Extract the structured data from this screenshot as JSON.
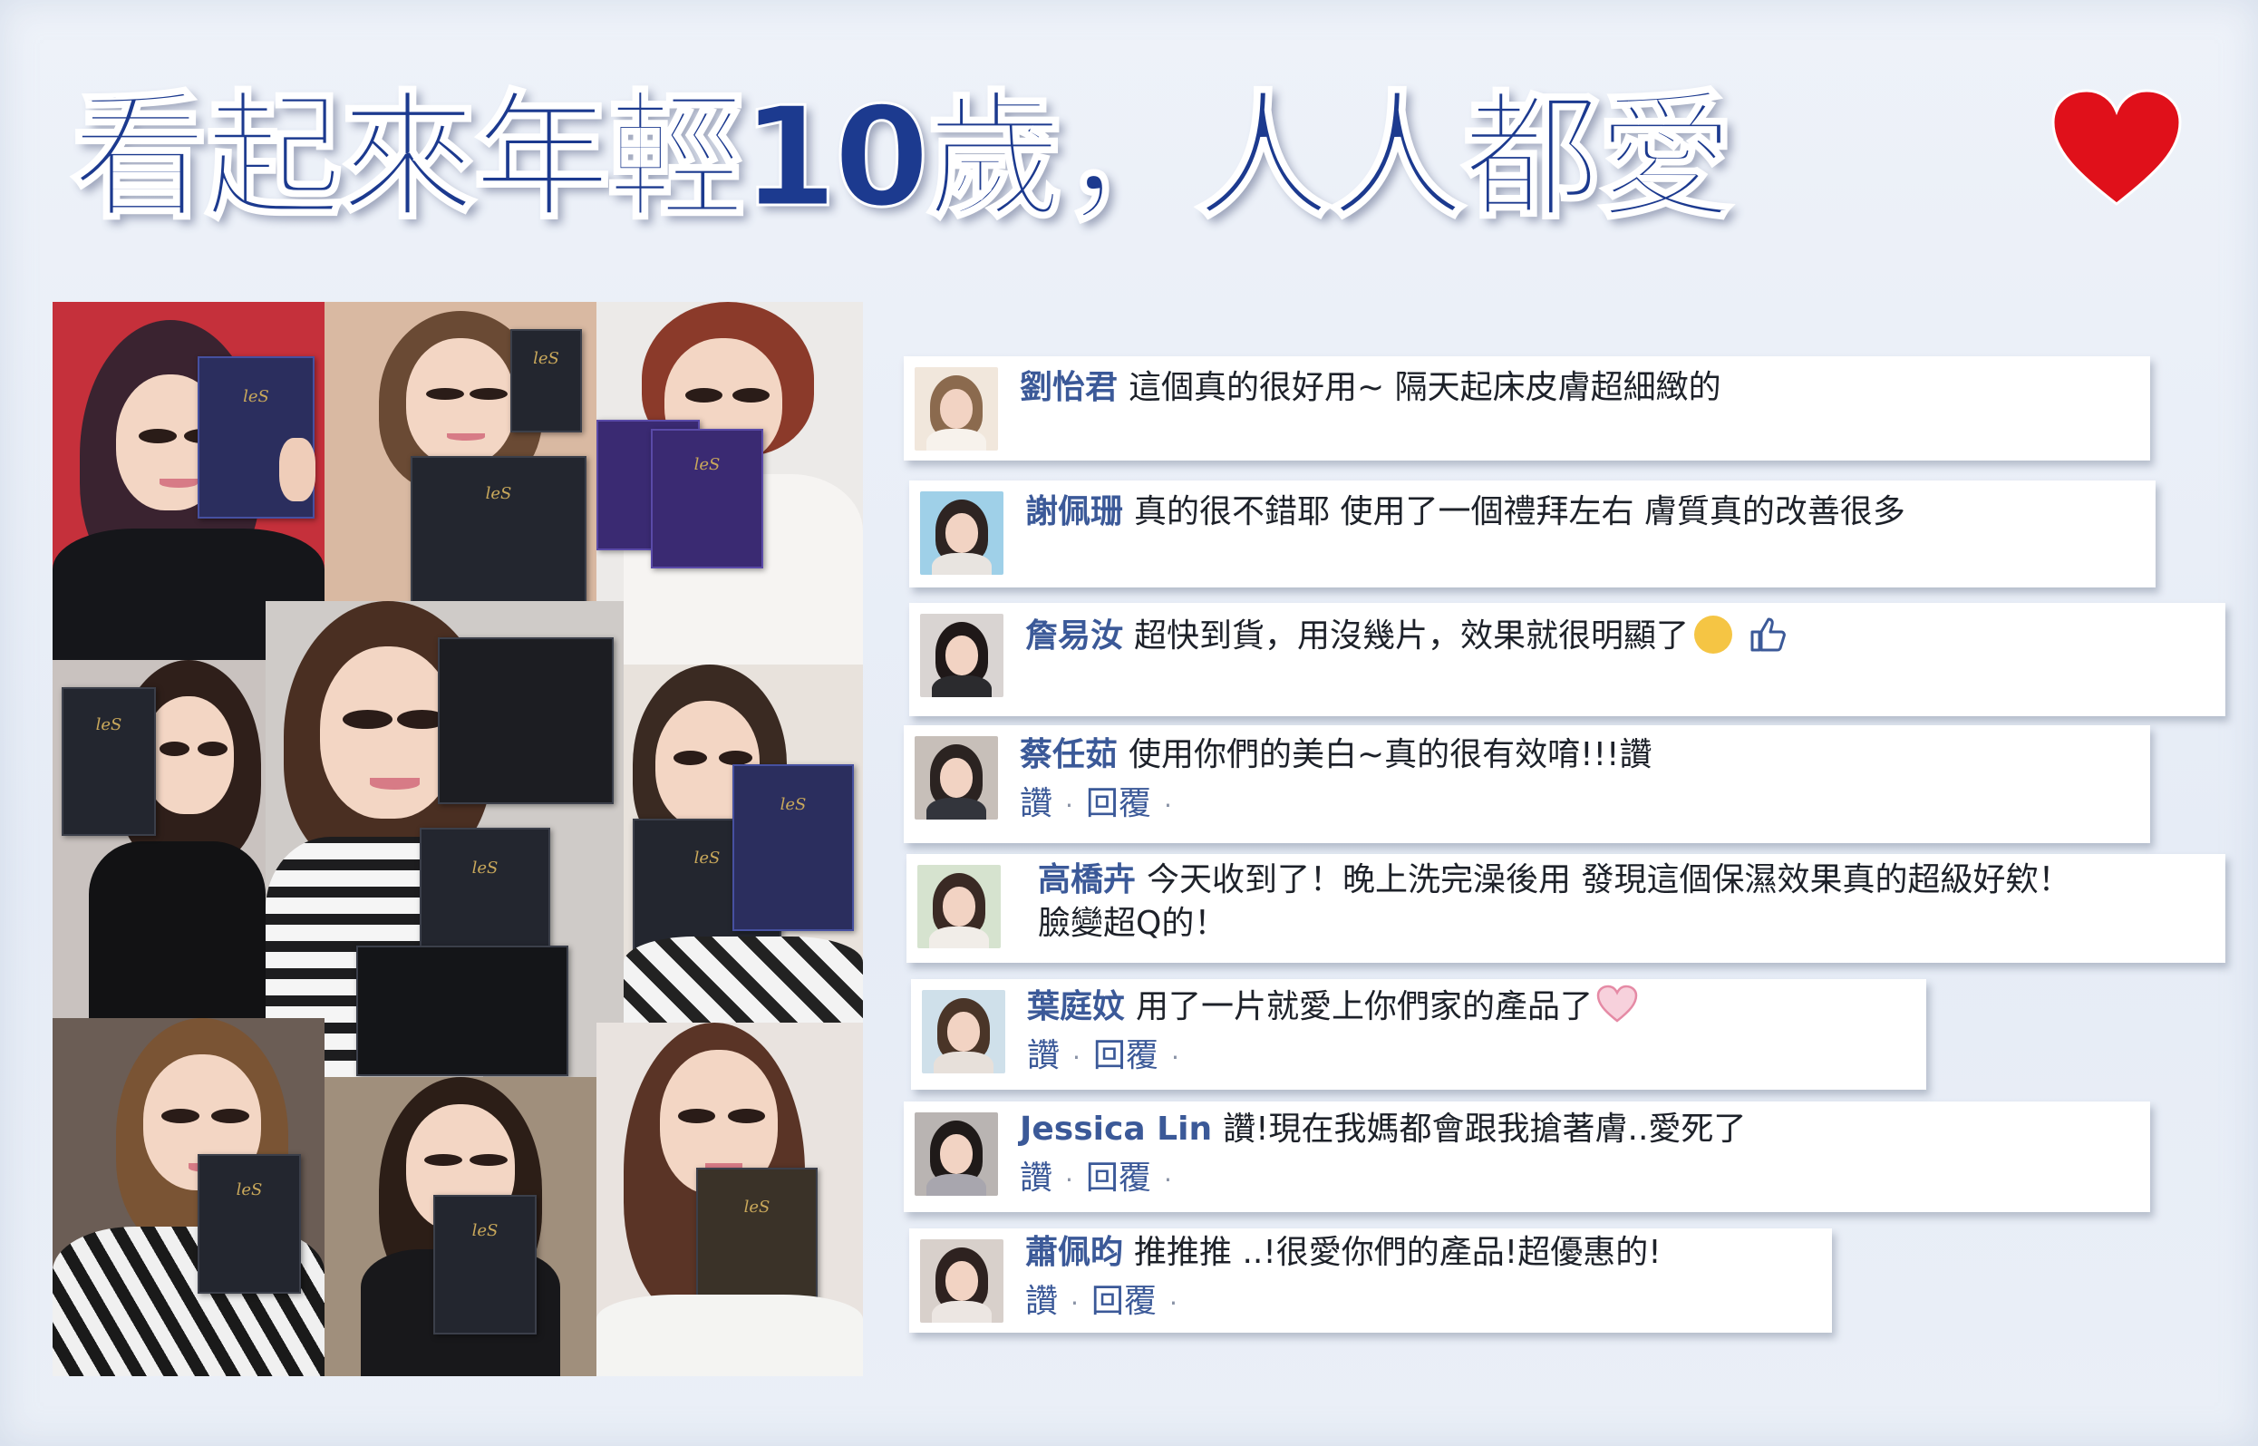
{
  "headline": "看起來年輕10歲，人人都愛",
  "heart_color": "#e0101a",
  "headline_color": "#1c3a8f",
  "link_color": "#3b5998",
  "comments": [
    {
      "name": "劉怡君",
      "lines": [
        "這個真的很好用~ 隔天起床皮膚超細緻的"
      ],
      "actions": null
    },
    {
      "name": "謝佩珊",
      "lines": [
        "真的很不錯耶 使用了一個禮拜左右 膚質真的改善很多"
      ],
      "actions": null
    },
    {
      "name": "詹易汝",
      "lines": [
        "超快到貨，用沒幾片，效果就很明顯了"
      ],
      "actions": null
    },
    {
      "name": "蔡任茹",
      "lines": [
        "使用你們的美白~真的很有效唷!!!讚"
      ],
      "actions": {
        "like": "讚",
        "reply": "回覆",
        "dot": "·"
      }
    },
    {
      "name": "高橋卉",
      "lines": [
        "今天收到了！晚上洗完澡後用 發現這個保濕效果真的超級好欸！",
        "臉變超Q的！"
      ],
      "actions": null
    },
    {
      "name": "葉庭妏",
      "lines": [
        "用了一片就愛上你們家的產品了"
      ],
      "actions": {
        "like": "讚",
        "reply": "回覆",
        "dot": "·"
      }
    },
    {
      "name": "Jessica Lin",
      "lines": [
        "讚!現在我媽都會跟我搶著膚..愛死了"
      ],
      "actions": {
        "like": "讚",
        "reply": "回覆",
        "dot": "·"
      }
    },
    {
      "name": "蕭佩昀",
      "lines": [
        "推推推 ..!很愛你們的產品!超優惠的!"
      ],
      "actions": {
        "like": "讚",
        "reply": "回覆",
        "dot": "·"
      }
    }
  ]
}
